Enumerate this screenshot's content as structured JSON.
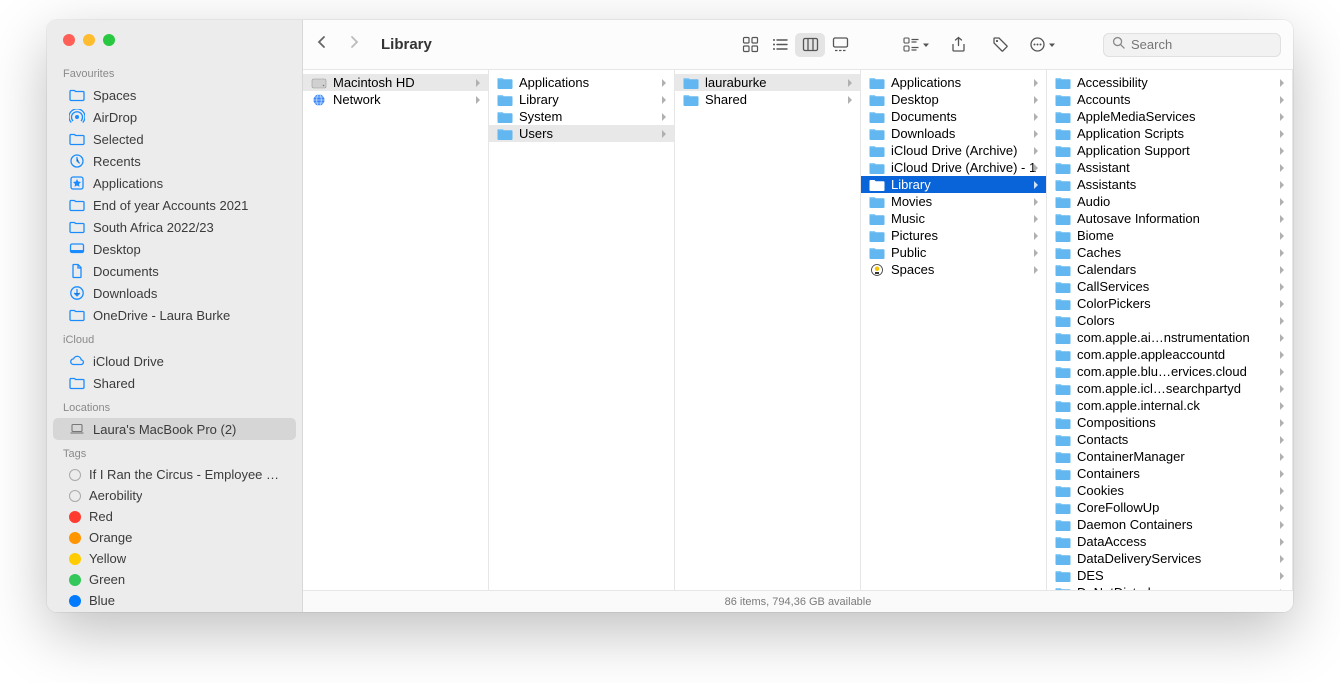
{
  "window": {
    "title": "Library"
  },
  "search": {
    "placeholder": "Search"
  },
  "status": "86 items, 794,36 GB available",
  "sidebar": {
    "favourites_label": "Favourites",
    "icloud_label": "iCloud",
    "locations_label": "Locations",
    "tags_label": "Tags",
    "favourites": [
      {
        "label": "Spaces",
        "icon": "folder"
      },
      {
        "label": "AirDrop",
        "icon": "airdrop"
      },
      {
        "label": "Selected",
        "icon": "folder"
      },
      {
        "label": "Recents",
        "icon": "clock"
      },
      {
        "label": "Applications",
        "icon": "apps"
      },
      {
        "label": "End of year Accounts 2021",
        "icon": "folder"
      },
      {
        "label": "South Africa 2022/23",
        "icon": "folder"
      },
      {
        "label": "Desktop",
        "icon": "desktop"
      },
      {
        "label": "Documents",
        "icon": "doc"
      },
      {
        "label": "Downloads",
        "icon": "download"
      },
      {
        "label": "OneDrive - Laura Burke",
        "icon": "folder"
      }
    ],
    "icloud": [
      {
        "label": "iCloud Drive",
        "icon": "cloud"
      },
      {
        "label": "Shared",
        "icon": "folder"
      }
    ],
    "locations": [
      {
        "label": "Laura's MacBook Pro (2)",
        "icon": "laptop",
        "selected": true
      }
    ],
    "tags": [
      {
        "label": "If I Ran the Circus - Employee brainstorm",
        "color": "none"
      },
      {
        "label": "Aerobility",
        "color": "none"
      },
      {
        "label": "Red",
        "color": "#ff3b30"
      },
      {
        "label": "Orange",
        "color": "#ff9500"
      },
      {
        "label": "Yellow",
        "color": "#ffcc00"
      },
      {
        "label": "Green",
        "color": "#34c759"
      },
      {
        "label": "Blue",
        "color": "#007aff"
      }
    ]
  },
  "columns": [
    {
      "items": [
        {
          "label": "Macintosh HD",
          "icon": "hdd",
          "path": true,
          "arrow": true
        },
        {
          "label": "Network",
          "icon": "globe",
          "arrow": true
        }
      ]
    },
    {
      "items": [
        {
          "label": "Applications",
          "icon": "folder",
          "arrow": true
        },
        {
          "label": "Library",
          "icon": "folder",
          "arrow": true
        },
        {
          "label": "System",
          "icon": "folder",
          "arrow": true
        },
        {
          "label": "Users",
          "icon": "folder",
          "path": true,
          "arrow": true
        }
      ]
    },
    {
      "items": [
        {
          "label": "lauraburke",
          "icon": "folder",
          "path": true,
          "arrow": true
        },
        {
          "label": "Shared",
          "icon": "folder",
          "arrow": true
        }
      ]
    },
    {
      "items": [
        {
          "label": "Applications",
          "icon": "folder",
          "arrow": true
        },
        {
          "label": "Desktop",
          "icon": "folder",
          "arrow": true
        },
        {
          "label": "Documents",
          "icon": "folder",
          "arrow": true
        },
        {
          "label": "Downloads",
          "icon": "folder",
          "arrow": true
        },
        {
          "label": "iCloud Drive (Archive)",
          "icon": "folder",
          "arrow": true
        },
        {
          "label": "iCloud Drive (Archive) - 1",
          "icon": "folder",
          "arrow": true
        },
        {
          "label": "Library",
          "icon": "folder",
          "selected": true,
          "arrow": true
        },
        {
          "label": "Movies",
          "icon": "folder",
          "arrow": true
        },
        {
          "label": "Music",
          "icon": "folder",
          "arrow": true
        },
        {
          "label": "Pictures",
          "icon": "folder",
          "arrow": true
        },
        {
          "label": "Public",
          "icon": "folder",
          "arrow": true
        },
        {
          "label": "Spaces",
          "icon": "spaces",
          "arrow": true
        }
      ]
    },
    {
      "items": [
        {
          "label": "Accessibility",
          "icon": "folder",
          "arrow": true
        },
        {
          "label": "Accounts",
          "icon": "folder",
          "arrow": true
        },
        {
          "label": "AppleMediaServices",
          "icon": "folder",
          "arrow": true
        },
        {
          "label": "Application Scripts",
          "icon": "folder",
          "arrow": true
        },
        {
          "label": "Application Support",
          "icon": "folder",
          "arrow": true
        },
        {
          "label": "Assistant",
          "icon": "folder",
          "arrow": true
        },
        {
          "label": "Assistants",
          "icon": "folder",
          "arrow": true
        },
        {
          "label": "Audio",
          "icon": "folder",
          "arrow": true
        },
        {
          "label": "Autosave Information",
          "icon": "folder",
          "arrow": true
        },
        {
          "label": "Biome",
          "icon": "folder",
          "arrow": true
        },
        {
          "label": "Caches",
          "icon": "folder",
          "arrow": true
        },
        {
          "label": "Calendars",
          "icon": "folder",
          "arrow": true
        },
        {
          "label": "CallServices",
          "icon": "folder",
          "arrow": true
        },
        {
          "label": "ColorPickers",
          "icon": "folder",
          "arrow": true
        },
        {
          "label": "Colors",
          "icon": "folder",
          "arrow": true
        },
        {
          "label": "com.apple.ai…nstrumentation",
          "icon": "folder",
          "arrow": true
        },
        {
          "label": "com.apple.appleaccountd",
          "icon": "folder",
          "arrow": true
        },
        {
          "label": "com.apple.blu…ervices.cloud",
          "icon": "folder",
          "arrow": true
        },
        {
          "label": "com.apple.icl…searchpartyd",
          "icon": "folder",
          "arrow": true
        },
        {
          "label": "com.apple.internal.ck",
          "icon": "folder",
          "arrow": true
        },
        {
          "label": "Compositions",
          "icon": "folder",
          "arrow": true
        },
        {
          "label": "Contacts",
          "icon": "folder",
          "arrow": true
        },
        {
          "label": "ContainerManager",
          "icon": "folder",
          "arrow": true
        },
        {
          "label": "Containers",
          "icon": "folder",
          "arrow": true
        },
        {
          "label": "Cookies",
          "icon": "folder",
          "arrow": true
        },
        {
          "label": "CoreFollowUp",
          "icon": "folder",
          "arrow": true
        },
        {
          "label": "Daemon Containers",
          "icon": "folder",
          "arrow": true
        },
        {
          "label": "DataAccess",
          "icon": "folder",
          "arrow": true
        },
        {
          "label": "DataDeliveryServices",
          "icon": "folder",
          "arrow": true
        },
        {
          "label": "DES",
          "icon": "folder",
          "arrow": true
        },
        {
          "label": "DoNotDisturb",
          "icon": "folder",
          "arrow": true
        }
      ]
    }
  ]
}
